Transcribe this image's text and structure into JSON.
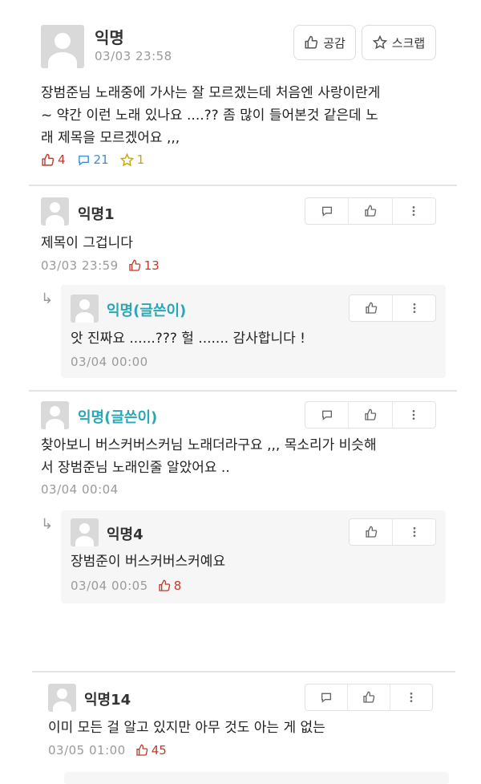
{
  "post": {
    "author": "익명",
    "timestamp": "03/03 23:58",
    "body_lines": [
      "장범준님 노래중에 가사는 잘 모르겠는데 처음엔 사랑이란게",
      "~ 약간 이런 노래 있나요 ....?? 좀 많이 들어본것 같은데 노",
      "래 제목을 모르겠어요 ,,,"
    ],
    "like_label": "공감",
    "scrap_label": "스크랩",
    "like_count": "4",
    "comment_count": "21",
    "scrap_count": "1"
  },
  "comments": [
    {
      "author": "익명1",
      "text": "제목이 그겁니다",
      "timestamp": "03/03 23:59",
      "likes": "13"
    },
    {
      "author": "익명(글쓴이)",
      "text": "앗 진짜요 ......??? 헐 ....... 감사합니다 !",
      "timestamp": "03/04 00:00",
      "likes": ""
    },
    {
      "author": "익명(글쓴이)",
      "text_lines": [
        "찾아보니 버스커버스커님 노래더라구요 ,,, 목소리가 비슷해",
        "서 장범준님 노래인줄 알았어요 .."
      ],
      "timestamp": "03/04 00:04",
      "likes": ""
    },
    {
      "author": "익명4",
      "text": "장범준이 버스커버스커예요",
      "timestamp": "03/04 00:05",
      "likes": "8"
    },
    {
      "author": "익명14",
      "text": "이미 모든 걸 알고 있지만 아무 것도 아는 게 없는",
      "timestamp": "03/05 01:00",
      "likes": "45"
    }
  ],
  "colors": {
    "author_accent": "#2aa7b5",
    "like_red": "#c0392b",
    "comment_blue": "#3a8fd8",
    "scrap_yellow": "#c9a400"
  }
}
